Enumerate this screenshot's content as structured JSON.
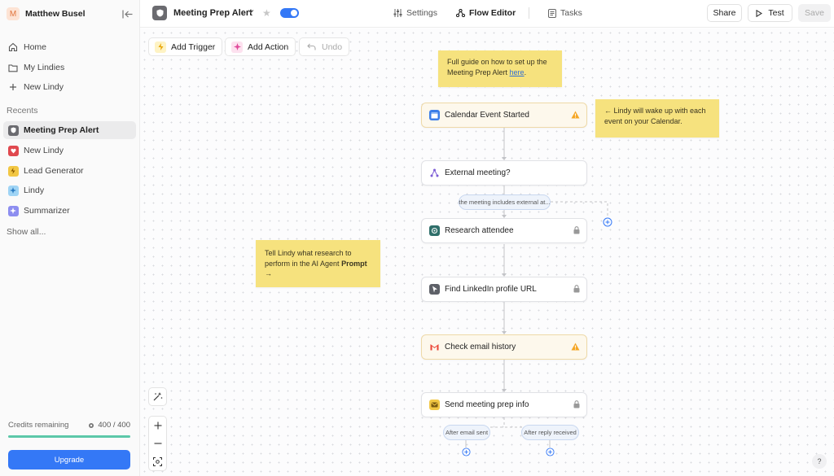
{
  "sidebar": {
    "user_initial": "M",
    "user_name": "Matthew Busel",
    "nav": [
      {
        "label": "Home",
        "icon": "home-icon"
      },
      {
        "label": "My Lindies",
        "icon": "folder-icon"
      },
      {
        "label": "New Lindy",
        "icon": "plus-icon"
      }
    ],
    "recents_label": "Recents",
    "recents": [
      {
        "label": "Meeting Prep Alert",
        "icon_color": "#6b6b70",
        "active": true
      },
      {
        "label": "New Lindy",
        "icon_color": "#e0494f",
        "active": false
      },
      {
        "label": "Lead Generator",
        "icon_color": "#f2c744",
        "active": false
      },
      {
        "label": "Lindy",
        "icon_color": "#9fd4f5",
        "active": false
      },
      {
        "label": "Summarizer",
        "icon_color": "#8d8ef0",
        "active": false
      }
    ],
    "show_all": "Show all...",
    "credits_label": "Credits remaining",
    "credits_value": "400 / 400",
    "credits_fraction": 1.0,
    "upgrade_label": "Upgrade"
  },
  "topbar": {
    "flow_title": "Meeting Prep Alert",
    "enabled": true,
    "tabs": [
      {
        "label": "Settings",
        "icon": "sliders-icon",
        "active": false
      },
      {
        "label": "Flow Editor",
        "icon": "flow-icon",
        "active": true
      },
      {
        "label": "Tasks",
        "icon": "tasks-icon",
        "active": false
      }
    ],
    "share_label": "Share",
    "test_label": "Test",
    "save_label": "Save"
  },
  "canvas": {
    "tools": {
      "add_trigger": "Add Trigger",
      "add_action": "Add Action",
      "undo": "Undo"
    },
    "notes": {
      "guide_prefix": "Full guide on how to set up the Meeting Prep Alert ",
      "guide_link": "here",
      "guide_suffix": ".",
      "calendar_note": "← Lindy will wake up with each event on your Calendar.",
      "research_note_text": "Tell Lindy what research to perform in the AI Agent ",
      "research_note_bold": "Prompt →"
    },
    "nodes": [
      {
        "label": "Calendar Event Started",
        "icon": "calendar-icon",
        "status": "warning"
      },
      {
        "label": "External meeting?",
        "icon": "branch-icon",
        "status": "none"
      },
      {
        "label": "Research attendee",
        "icon": "agent-icon",
        "status": "locked"
      },
      {
        "label": "Find LinkedIn profile URL",
        "icon": "cursor-icon",
        "status": "locked"
      },
      {
        "label": "Check email history",
        "icon": "gmail-icon",
        "status": "warning"
      },
      {
        "label": "Send meeting prep info",
        "icon": "message-icon",
        "status": "locked"
      }
    ],
    "condition_pill": "the meeting includes external at...",
    "branch_pills": {
      "left": "After email sent",
      "right": "After reply received"
    },
    "help": "?"
  }
}
